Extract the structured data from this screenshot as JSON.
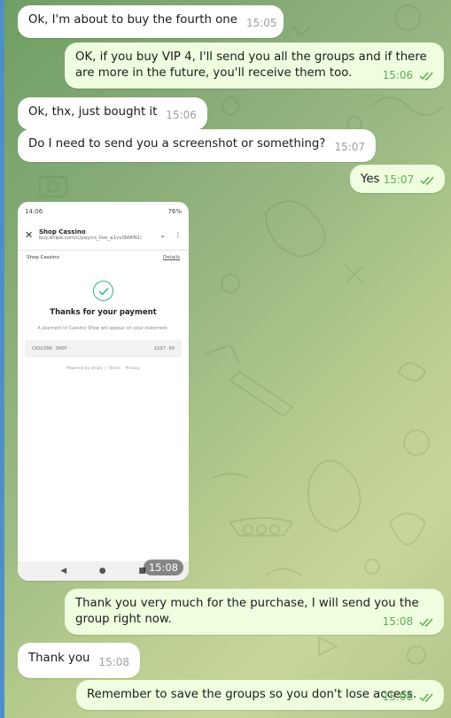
{
  "messages": [
    {
      "dir": "in",
      "text": "Ok, I'm about to buy the fourth one",
      "time": "15:05"
    },
    {
      "dir": "out",
      "text": "OK, if you buy VIP 4, I'll send you all the groups and if there are more in the future, you'll receive them too.",
      "time": "15:06",
      "read": true
    },
    {
      "dir": "in",
      "text": "Ok, thx, just bought it",
      "time": "15:06"
    },
    {
      "dir": "in",
      "text": "Do I need to send you a screenshot or something?",
      "time": "15:07"
    },
    {
      "dir": "out",
      "text": "Yes",
      "time": "15:07",
      "read": true
    },
    {
      "dir": "out",
      "text": "Thank you very much for the purchase, I will send you the group right now.",
      "time": "15:08",
      "read": true
    },
    {
      "dir": "in",
      "text": "Thank you",
      "time": "15:08"
    },
    {
      "dir": "out",
      "text": "Remember to save the groups so you don't lose access.",
      "time": "15:08",
      "read": true
    }
  ],
  "image_message": {
    "time": "15:08",
    "phone": {
      "status_time": "14:06",
      "status_right": "76%",
      "site_title": "Shop Cassino",
      "site_url": "buy.stripe.com/c/pay/cs_live_a1vv0NWN1i",
      "merchant": "Shop Cassino",
      "details": "Details",
      "heading": "Thanks for your payment",
      "note": "A payment to Cassino SHop will appear on your statement.",
      "line_item": "CASSINO SHOP",
      "amount": "$197.00",
      "footer_powered": "Powered by stripe",
      "footer_terms": "Terms",
      "footer_privacy": "Privacy"
    }
  },
  "colors": {
    "incoming_bubble": "#ffffff",
    "outgoing_bubble": "#eefedf",
    "outgoing_time": "#62ac55",
    "incoming_time": "#a0a0a0"
  },
  "icons": [
    "double-check-icon",
    "close-icon",
    "share-icon",
    "menu-dots-icon",
    "check-circle-icon",
    "back-nav-icon",
    "home-nav-icon",
    "recents-nav-icon"
  ]
}
